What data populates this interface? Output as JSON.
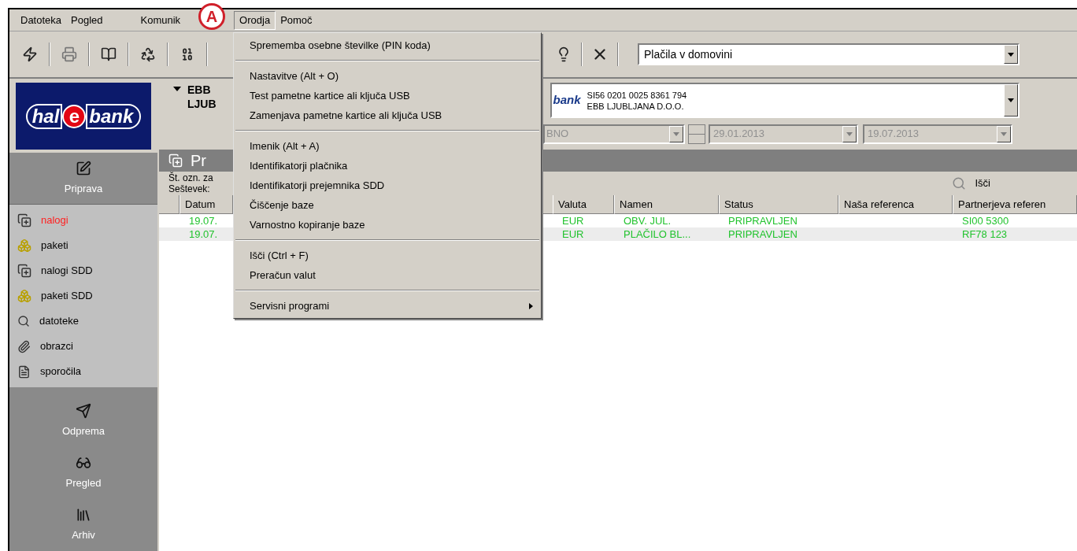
{
  "menu_bar": [
    {
      "label": "Datoteka",
      "selected": false
    },
    {
      "label": "Pogled",
      "selected": false
    },
    {
      "label": "Komunik",
      "selected": false
    },
    {
      "label": "Orodja",
      "selected": true
    },
    {
      "label": "Pomoč",
      "selected": false
    }
  ],
  "annotation": {
    "label": "A"
  },
  "toolbar": {
    "view_select": {
      "value": "Plačila v domovini"
    }
  },
  "logo": {
    "part_1": "hal",
    "part_2": "e",
    "part_3": "bank"
  },
  "sidebar": {
    "sections": [
      {
        "label": "Priprava",
        "selected": true,
        "items": [
          {
            "label": "nalogi",
            "selected": true
          },
          {
            "label": "paketi",
            "selected": false
          },
          {
            "label": "nalogi SDD",
            "selected": false
          },
          {
            "label": "paketi SDD",
            "selected": false
          },
          {
            "label": "datoteke",
            "selected": false
          },
          {
            "label": "obrazci",
            "selected": false
          },
          {
            "label": "sporočila",
            "selected": false
          }
        ]
      },
      {
        "label": "Odprema",
        "selected": false
      },
      {
        "label": "Pregled",
        "selected": false
      },
      {
        "label": "Arhiv",
        "selected": false
      }
    ]
  },
  "header": {
    "client_lines": [
      "EBB",
      "LJUB"
    ],
    "account": {
      "logo_text": "bank",
      "iban": "SI56 0201 0025 8361 794",
      "name": "EBB LJUBLJANA D.O.O."
    },
    "filters": {
      "disabled": true,
      "type_value": "BNO",
      "date_from": "29.01.2013",
      "date_to": "19.07.2013"
    }
  },
  "title_bar": {
    "title": "Pr"
  },
  "summary": [
    "Št. ozn. za",
    "Seštevek:"
  ],
  "search": {
    "label": "Išči"
  },
  "table": {
    "columns": [
      "Datum",
      "Valuta",
      "Namen",
      "Status",
      "Naša referenca",
      "Partnerjeva referen"
    ],
    "rows": [
      {
        "cells": [
          "19.07.",
          "EUR",
          "OBV. JUL.",
          "PRIPRAVLJEN",
          null,
          "SI00 5300"
        ]
      },
      {
        "cells": [
          "19.07.",
          "EUR",
          "PLAČILO BL...",
          "PRIPRAVLJEN",
          null,
          "RF78 123"
        ]
      }
    ]
  },
  "menu": {
    "groups": [
      [
        {
          "label": "Sprememba osebne številke (PIN koda)",
          "submenu": false
        }
      ],
      [
        {
          "label": "Nastavitve (Alt + O)",
          "submenu": false
        },
        {
          "label": "Test pametne kartice ali ključa USB",
          "submenu": false
        },
        {
          "label": "Zamenjava pametne kartice ali ključa USB",
          "submenu": false
        }
      ],
      [
        {
          "label": "Imenik (Alt + A)",
          "submenu": false
        },
        {
          "label": "Identifikatorji plačnika",
          "submenu": false
        },
        {
          "label": "Identifikatorji prejemnika SDD",
          "submenu": false
        },
        {
          "label": "Čiščenje baze",
          "submenu": false
        },
        {
          "label": "Varnostno kopiranje baze",
          "submenu": false
        }
      ],
      [
        {
          "label": "Išči (Ctrl + F)",
          "submenu": false
        },
        {
          "label": "Preračun valut",
          "submenu": false
        }
      ],
      [
        {
          "label": "Servisni programi",
          "submenu": true
        }
      ]
    ]
  }
}
